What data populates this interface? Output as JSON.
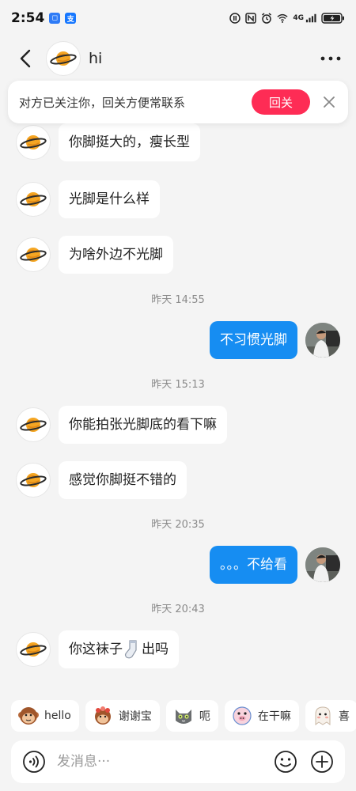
{
  "status_bar": {
    "time": "2:54",
    "network": "4G"
  },
  "header": {
    "contact_name": "hi"
  },
  "follow_banner": {
    "text": "对方已关注你，回关方便常联系",
    "button_label": "回关"
  },
  "messages": [
    {
      "side": "in",
      "text": "你脚挺大的，瘦长型"
    },
    {
      "side": "in",
      "text": "光脚是什么样"
    },
    {
      "side": "in",
      "text": "为啥外边不光脚"
    },
    {
      "side": "out",
      "text": "不习惯光脚"
    },
    {
      "side": "in",
      "text": "你能拍张光脚底的看下嘛"
    },
    {
      "side": "in",
      "text": "感觉你脚挺不错的"
    },
    {
      "side": "out",
      "text": "。。。不给看"
    },
    {
      "side": "in",
      "text_before": "你这袜子",
      "text_after": "出吗"
    }
  ],
  "timestamps": [
    "昨天 14:55",
    "昨天 15:13",
    "昨天 20:35",
    "昨天 20:43"
  ],
  "stickers": [
    {
      "label": "hello",
      "icon": "monkey-icon"
    },
    {
      "label": "谢谢宝",
      "icon": "monkey-flower-icon"
    },
    {
      "label": "呃",
      "icon": "cat-icon"
    },
    {
      "label": "在干嘛",
      "icon": "pig-icon"
    },
    {
      "label": "喜",
      "icon": "ghost-icon"
    }
  ],
  "input": {
    "placeholder": "发消息···"
  },
  "colors": {
    "accent_blue": "#168df2",
    "follow_red": "#fe2c55",
    "background": "#f4f4f4"
  }
}
